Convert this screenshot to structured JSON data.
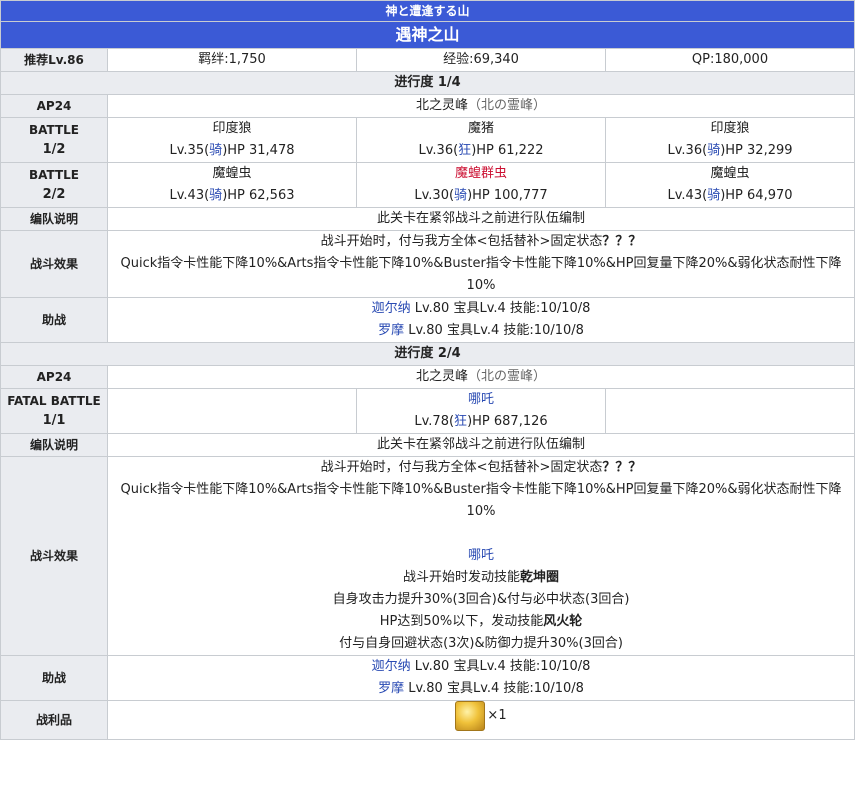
{
  "header": {
    "subtitle": "神と遭逢する山",
    "title": "遇神之山"
  },
  "info": {
    "level": "推荐Lv.86",
    "bond": "羁绊:1,750",
    "exp": "经验:69,340",
    "qp": "QP:180,000"
  },
  "stages": [
    {
      "progress": "进行度 1/4",
      "ap": "AP24",
      "location": "北之灵峰",
      "location_jp": "（北の霊峰）",
      "battles": [
        {
          "label": "BATTLE",
          "count": "1/2",
          "enemies": [
            {
              "name": "印度狼",
              "lv": "Lv.35(",
              "cls": "骑",
              "hp": ")HP 31,478"
            },
            {
              "name": "魔猪",
              "lv": "Lv.36(",
              "cls": "狂",
              "hp": ")HP 61,222"
            },
            {
              "name": "印度狼",
              "lv": "Lv.36(",
              "cls": "骑",
              "hp": ")HP 32,299"
            }
          ]
        },
        {
          "label": "BATTLE",
          "count": "2/2",
          "enemies": [
            {
              "name": "魔蝗虫",
              "lv": "Lv.43(",
              "cls": "骑",
              "hp": ")HP 62,563"
            },
            {
              "name": "魔蝗群虫",
              "lv": "Lv.30(",
              "cls": "骑",
              "hp": ")HP 100,777"
            },
            {
              "name": "魔蝗虫",
              "lv": "Lv.43(",
              "cls": "骑",
              "hp": ")HP 64,970"
            }
          ]
        }
      ],
      "formation_label": "编队说明",
      "formation_text": "此关卡在紧邻战斗之前进行队伍编制",
      "effect_label": "战斗效果",
      "effect_line1": "战斗开始时，付与我方全体<包括替补>固定状态",
      "effect_q": "？？？",
      "effect_line2": "Quick指令卡性能下降10%&Arts指令卡性能下降10%&Buster指令卡性能下降10%&HP回复量下降20%&弱化状态耐性下降10%",
      "support_label": "助战",
      "supports": [
        {
          "name": "迦尔纳",
          "info": " Lv.80 宝具Lv.4 技能:10/10/8"
        },
        {
          "name": "罗摩",
          "info": " Lv.80 宝具Lv.4 技能:10/10/8"
        }
      ]
    },
    {
      "progress": "进行度 2/4",
      "ap": "AP24",
      "location": "北之灵峰",
      "location_jp": "（北の霊峰）",
      "battle": {
        "label": "FATAL BATTLE",
        "count": "1/1",
        "enemy": {
          "name": "哪吒",
          "lv": "Lv.78(",
          "cls": "狂",
          "hp": ")HP 687,126"
        }
      },
      "formation_label": "编队说明",
      "formation_text": "此关卡在紧邻战斗之前进行队伍编制",
      "effect_label": "战斗效果",
      "effect_line1": "战斗开始时，付与我方全体<包括替补>固定状态",
      "effect_q": "？？？",
      "effect_line2": "Quick指令卡性能下降10%&Arts指令卡性能下降10%&Buster指令卡性能下降10%&HP回复量下降20%&弱化状态耐性下降10%",
      "boss_name": "哪吒",
      "boss_line1_pre": "战斗开始时发动技能",
      "boss_line1_skill": "乾坤圈",
      "boss_line2": "自身攻击力提升30%(3回合)&付与必中状态(3回合)",
      "boss_line3_pre": "HP达到50%以下，发动技能",
      "boss_line3_skill": "风火轮",
      "boss_line4": "付与自身回避状态(3次)&防御力提升30%(3回合)",
      "support_label": "助战",
      "supports": [
        {
          "name": "迦尔纳",
          "info": " Lv.80 宝具Lv.4 技能:10/10/8"
        },
        {
          "name": "罗摩",
          "info": " Lv.80 宝具Lv.4 技能:10/10/8"
        }
      ],
      "drop_label": "战利品",
      "drop_icon": "gold-statue-icon",
      "drop_count": "×1"
    }
  ]
}
